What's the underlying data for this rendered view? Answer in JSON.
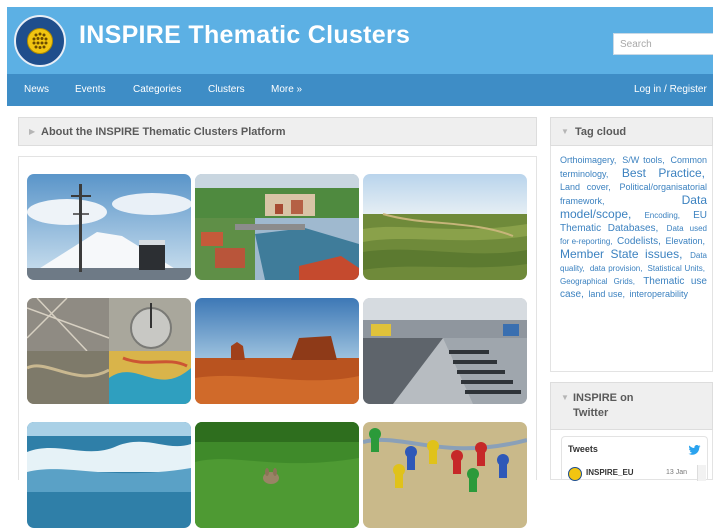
{
  "header": {
    "site_title": "INSPIRE Thematic Clusters",
    "search_placeholder": "Search",
    "colors": {
      "header_bg": "#5cb0e4",
      "nav_bg": "#3e8dc6",
      "link": "#3c82c0"
    }
  },
  "nav": {
    "items": [
      "News",
      "Events",
      "Categories",
      "Clusters",
      "More »"
    ],
    "login": "Log in / Register"
  },
  "main": {
    "panel_title": "About the INSPIRE Thematic Clusters Platform",
    "tiles": [
      "weather-mast-mountain",
      "lakeside-town",
      "aerial-landscape",
      "map-mosaic",
      "desert-butte",
      "industrial-hall",
      "ocean-waves",
      "grass-animal",
      "game-pieces-map"
    ]
  },
  "sidebar": {
    "tag_cloud_title": "Tag cloud",
    "tags": [
      {
        "text": "Orthoimagery,",
        "size": "s"
      },
      {
        "text": "S/W tools,",
        "size": "s"
      },
      {
        "text": "Common terminology,",
        "size": "s"
      },
      {
        "text": "Best Practice,",
        "size": "l"
      },
      {
        "text": "Land cover,",
        "size": "s"
      },
      {
        "text": "Political/organisatorial framework,",
        "size": "s"
      },
      {
        "text": "Data model/scope,",
        "size": "l"
      },
      {
        "text": "Encoding,",
        "size": "xs"
      },
      {
        "text": "EU Thematic Databases,",
        "size": "m"
      },
      {
        "text": "Data used for e-reporting,",
        "size": "xs"
      },
      {
        "text": "Codelists,",
        "size": "m"
      },
      {
        "text": "Elevation,",
        "size": "s"
      },
      {
        "text": "Member State issues,",
        "size": "l"
      },
      {
        "text": "Data quality,",
        "size": "xs"
      },
      {
        "text": "data provision,",
        "size": "xs"
      },
      {
        "text": "Statistical Units,",
        "size": "xs"
      },
      {
        "text": "Geographical Grids,",
        "size": "xs"
      },
      {
        "text": "Thematic use case,",
        "size": "m"
      },
      {
        "text": "land use,",
        "size": "s"
      },
      {
        "text": "interoperability",
        "size": "s"
      }
    ],
    "twitter_title_line1": "INSPIRE on",
    "twitter_title_line2": "Twitter",
    "tweets_label": "Tweets",
    "tweet_user": "INSPIRE_EU",
    "tweet_date": "13 Jan"
  }
}
